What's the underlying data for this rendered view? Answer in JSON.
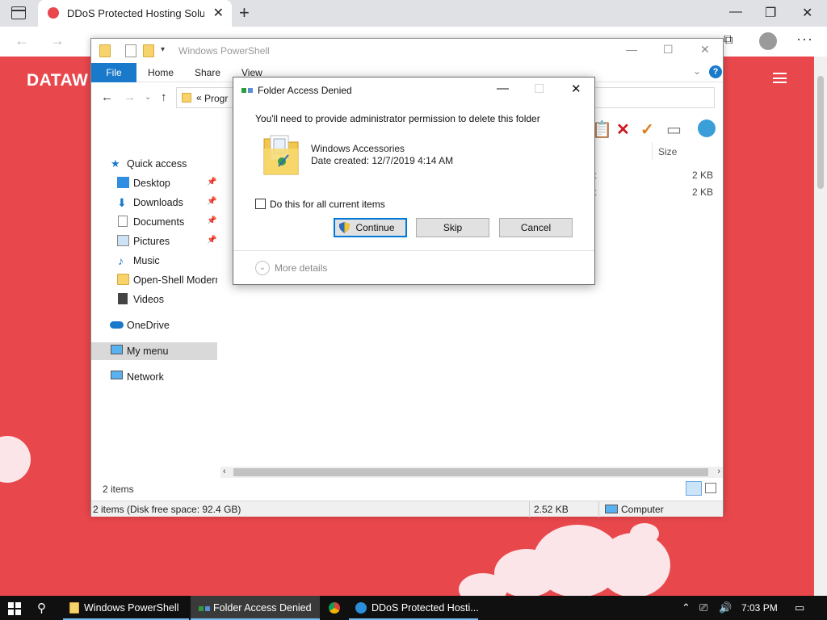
{
  "browser": {
    "tab_title": "DDoS Protected Hosting Solutio",
    "tab_close": "✕",
    "new_tab": "+",
    "minimize": "—",
    "maximize": "❐",
    "close": "✕",
    "back": "←",
    "forward": "→",
    "more": "···"
  },
  "page": {
    "logo": "DATAW"
  },
  "explorer": {
    "title": "Windows PowerShell",
    "ribbon_tabs": [
      "File",
      "Home",
      "Share",
      "View"
    ],
    "help": "?",
    "address": "Progr",
    "address_prefix": "«",
    "column_size": "Size",
    "file_sizes": [
      "2 KB",
      "2 KB"
    ],
    "file_fragments": [
      "t",
      "t"
    ],
    "nav": {
      "quick_access": "Quick access",
      "desktop": "Desktop",
      "downloads": "Downloads",
      "documents": "Documents",
      "pictures": "Pictures",
      "music": "Music",
      "open_shell": "Open-Shell Modern",
      "videos": "Videos",
      "onedrive": "OneDrive",
      "my_menu": "My menu",
      "network": "Network"
    },
    "items_count": "2 items",
    "status": {
      "items": "2 items (Disk free space: 92.4 GB)",
      "size": "2.52 KB",
      "location": "Computer"
    }
  },
  "dialog": {
    "title": "Folder Access Denied",
    "message": "You'll need to provide administrator permission to delete this folder",
    "item_name": "Windows Accessories",
    "item_date": "Date created: 12/7/2019 4:14 AM",
    "checkbox_label": "Do this for all current items",
    "continue": "Continue",
    "skip": "Skip",
    "cancel": "Cancel",
    "more_details": "More details",
    "minimize": "—",
    "maximize": "☐",
    "close": "✕"
  },
  "taskbar": {
    "apps": [
      "Windows PowerShell",
      "Folder Access Denied",
      "DDoS Protected Hosti..."
    ],
    "clock": "7:03 PM"
  },
  "colors": {
    "accent": "#1979ca",
    "page_bg": "#e8474c"
  }
}
